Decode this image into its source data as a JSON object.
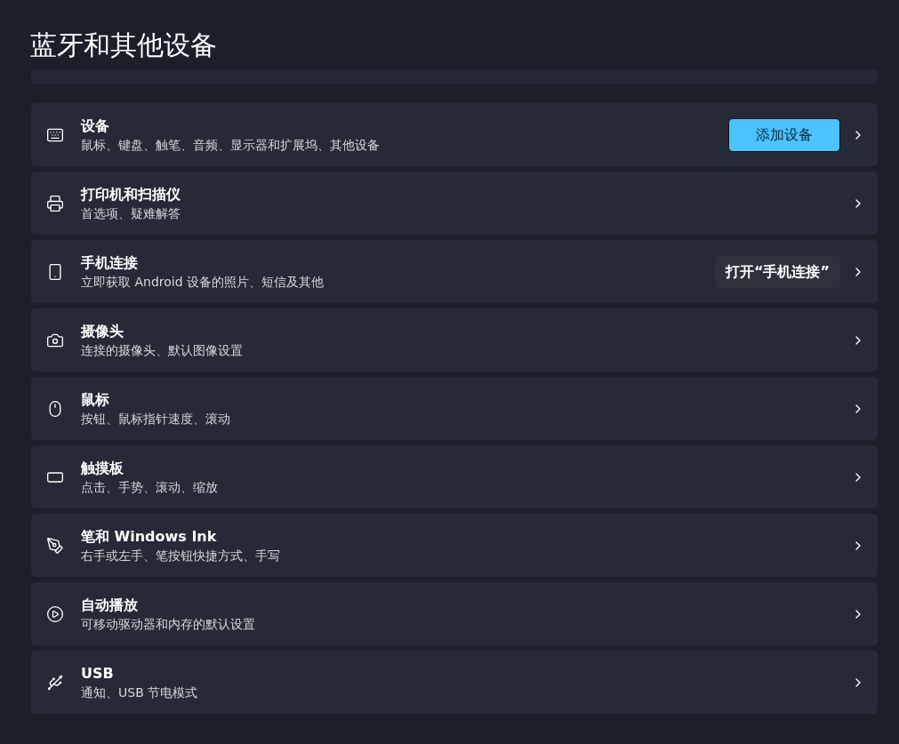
{
  "page_title": "蓝牙和其他设备",
  "items": [
    {
      "title": "设备",
      "subtitle": "鼠标、键盘、触笔、音频、显示器和扩展坞、其他设备",
      "button": {
        "kind": "accent",
        "label": "添加设备"
      }
    },
    {
      "title": "打印机和扫描仪",
      "subtitle": "首选项、疑难解答"
    },
    {
      "title": "手机连接",
      "subtitle": "立即获取 Android 设备的照片、短信及其他",
      "button": {
        "kind": "secondary",
        "label": "打开“手机连接”"
      }
    },
    {
      "title": "摄像头",
      "subtitle": "连接的摄像头、默认图像设置"
    },
    {
      "title": "鼠标",
      "subtitle": "按钮、鼠标指针速度、滚动"
    },
    {
      "title": "触摸板",
      "subtitle": "点击、手势、滚动、缩放"
    },
    {
      "title": "笔和 Windows Ink",
      "subtitle": "右手或左手、笔按钮快捷方式、手写"
    },
    {
      "title": "自动播放",
      "subtitle": "可移动驱动器和内存的默认设置"
    },
    {
      "title": "USB",
      "subtitle": "通知、USB 节电模式"
    }
  ]
}
